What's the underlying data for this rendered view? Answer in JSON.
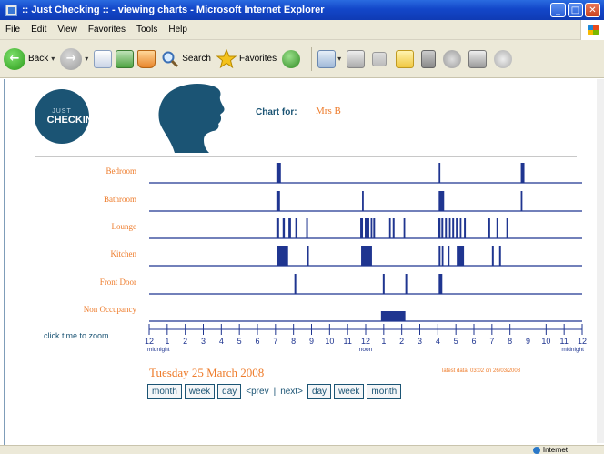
{
  "window": {
    "title": ":: Just Checking :: - viewing charts - Microsoft Internet Explorer",
    "minimize": "_",
    "maximize": "□",
    "close": "✕"
  },
  "menu": [
    "File",
    "Edit",
    "View",
    "Favorites",
    "Tools",
    "Help"
  ],
  "toolbar": {
    "back_label": "Back",
    "search_label": "Search",
    "favorites_label": "Favorites"
  },
  "status": {
    "zone": "Internet"
  },
  "header": {
    "logo_top": "JUST",
    "logo_main": "CHECKING",
    "chart_for_label": "Chart for:",
    "chart_for_name": "Mrs B"
  },
  "rows": [
    "Bedroom",
    "Bathroom",
    "Lounge",
    "Kitchen",
    "Front Door",
    "Non Occupancy"
  ],
  "zoom_label": "click time to zoom",
  "axis": {
    "ticks": [
      "12",
      "1",
      "2",
      "3",
      "4",
      "5",
      "6",
      "7",
      "8",
      "9",
      "10",
      "11",
      "12",
      "1",
      "2",
      "3",
      "4",
      "5",
      "6",
      "7",
      "8",
      "9",
      "10",
      "11",
      "12"
    ],
    "sublabels": {
      "start": "midnight",
      "noon": "noon",
      "end": "midnight"
    }
  },
  "date": "Tuesday 25 March 2008",
  "latest_data": "latest data: 03:02 on 26/03/2008",
  "nav": {
    "left_buttons": [
      "month",
      "week",
      "day"
    ],
    "prev": "<prev",
    "sep": "|",
    "next": "next>",
    "right_buttons": [
      "day",
      "week",
      "month"
    ]
  },
  "colors": {
    "accent": "#ee7b2a",
    "bar": "#1f3590",
    "brand": "#1b5474"
  },
  "chart_data": {
    "type": "timeline",
    "x_unit": "hour of day (0 = midnight, 24 = midnight)",
    "x_range": [
      0,
      24
    ],
    "series": [
      {
        "name": "Bedroom",
        "intervals": [
          [
            7.05,
            7.3
          ],
          [
            16.05,
            16.12
          ],
          [
            20.6,
            20.8
          ]
        ]
      },
      {
        "name": "Bathroom",
        "intervals": [
          [
            7.05,
            7.25
          ],
          [
            11.8,
            11.88
          ],
          [
            16.05,
            16.35
          ],
          [
            20.6,
            20.68
          ]
        ]
      },
      {
        "name": "Lounge",
        "intervals": [
          [
            7.05,
            7.2
          ],
          [
            7.4,
            7.52
          ],
          [
            7.72,
            7.86
          ],
          [
            8.1,
            8.22
          ],
          [
            8.7,
            8.8
          ],
          [
            11.7,
            11.85
          ],
          [
            11.95,
            12.05
          ],
          [
            12.1,
            12.2
          ],
          [
            12.28,
            12.36
          ],
          [
            12.42,
            12.52
          ],
          [
            13.3,
            13.38
          ],
          [
            13.5,
            13.6
          ],
          [
            14.1,
            14.18
          ],
          [
            16.0,
            16.15
          ],
          [
            16.2,
            16.3
          ],
          [
            16.4,
            16.5
          ],
          [
            16.62,
            16.7
          ],
          [
            16.8,
            16.9
          ],
          [
            17.0,
            17.08
          ],
          [
            17.22,
            17.3
          ],
          [
            17.45,
            17.55
          ],
          [
            18.8,
            18.9
          ],
          [
            19.25,
            19.35
          ],
          [
            19.8,
            19.9
          ]
        ]
      },
      {
        "name": "Kitchen",
        "intervals": [
          [
            7.1,
            7.7
          ],
          [
            8.75,
            8.85
          ],
          [
            11.75,
            12.35
          ],
          [
            16.05,
            16.15
          ],
          [
            16.22,
            16.3
          ],
          [
            16.55,
            16.65
          ],
          [
            17.05,
            17.45
          ],
          [
            19.0,
            19.1
          ],
          [
            19.4,
            19.5
          ]
        ]
      },
      {
        "name": "Front Door",
        "intervals": [
          [
            8.05,
            8.15
          ],
          [
            12.95,
            13.05
          ],
          [
            14.2,
            14.3
          ],
          [
            16.05,
            16.25
          ]
        ]
      },
      {
        "name": "Non Occupancy",
        "intervals": [
          [
            12.85,
            14.2
          ]
        ]
      }
    ]
  }
}
